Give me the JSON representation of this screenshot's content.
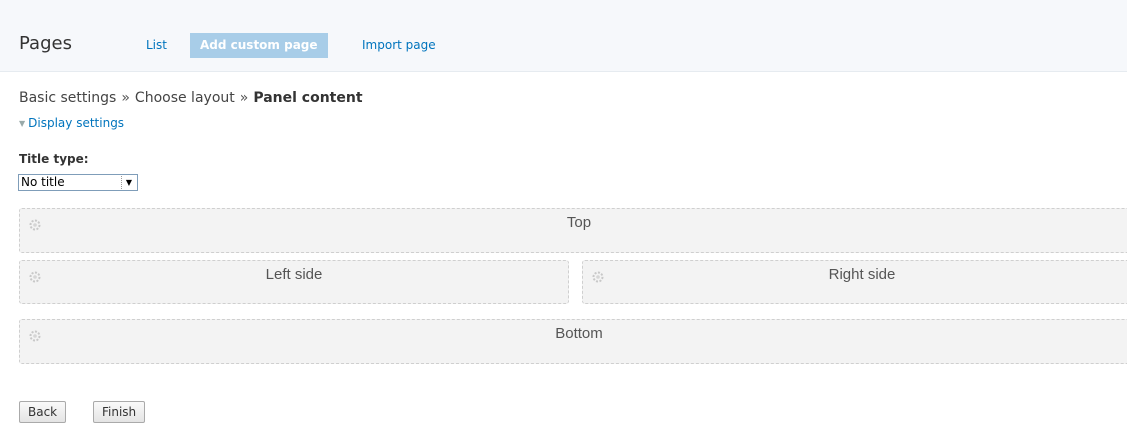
{
  "header": {
    "title": "Pages",
    "tabs": [
      {
        "label": "List",
        "active": false
      },
      {
        "label": "Add custom page",
        "active": true
      },
      {
        "label": "Import page",
        "active": false
      }
    ]
  },
  "breadcrumb": {
    "steps": [
      "Basic settings",
      "Choose layout",
      "Panel content"
    ],
    "separator": "»"
  },
  "display_settings": {
    "label": "Display settings"
  },
  "title_type": {
    "label": "Title type:",
    "selected": "No title"
  },
  "regions": {
    "top": "Top",
    "left": "Left side",
    "right": "Right side",
    "bottom": "Bottom"
  },
  "buttons": {
    "back": "Back",
    "finish": "Finish"
  },
  "colors": {
    "link": "#0074bd",
    "active_tab_bg": "#a8cde8",
    "region_bg": "#f3f3f3"
  }
}
